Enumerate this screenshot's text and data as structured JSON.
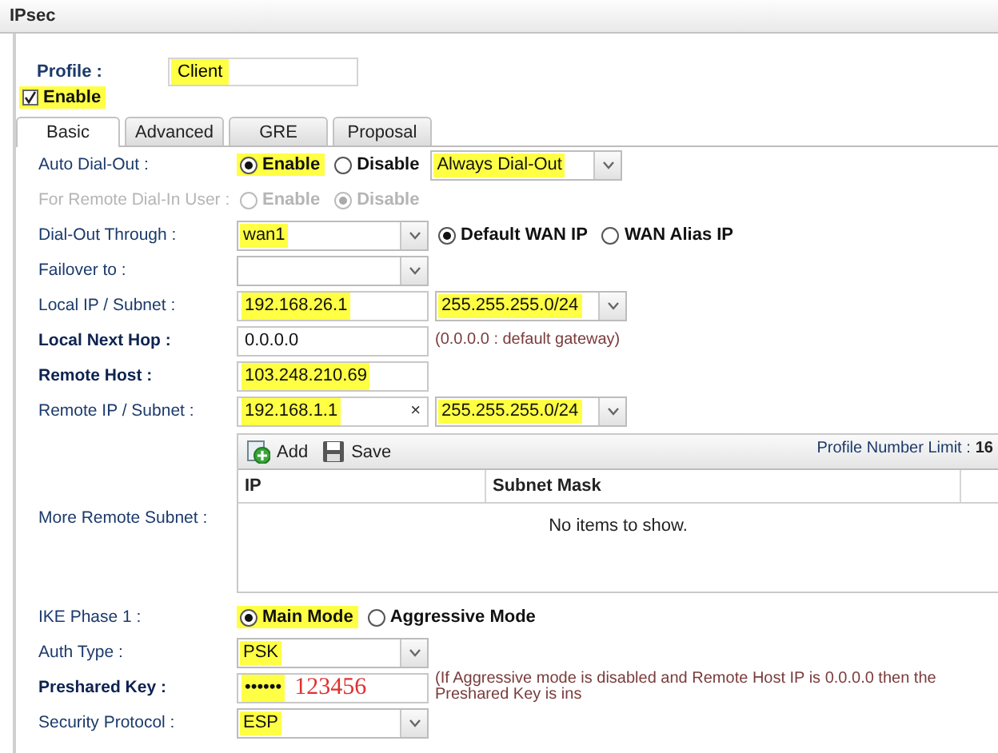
{
  "window": {
    "title": "IPsec"
  },
  "profile": {
    "label": "Profile :",
    "value": "Client",
    "highlighted": true
  },
  "enable": {
    "label": "Enable",
    "checked": true,
    "highlighted": true
  },
  "tabs": [
    {
      "label": "Basic",
      "selected": true
    },
    {
      "label": "Advanced",
      "selected": false
    },
    {
      "label": "GRE",
      "selected": false
    },
    {
      "label": "Proposal",
      "selected": false
    }
  ],
  "rows": [
    {
      "kind": "fields",
      "label": "Auto Dial-Out :",
      "bold": false,
      "disabled": false,
      "controls": [
        {
          "kind": "radio",
          "label": "Enable",
          "selected": true,
          "highlighted": true
        },
        {
          "kind": "radio",
          "label": "Disable",
          "selected": false,
          "highlighted": false
        },
        {
          "kind": "select",
          "value": "Always Dial-Out",
          "highlighted": true
        }
      ]
    },
    {
      "kind": "fields",
      "label": "For Remote Dial-In User :",
      "bold": false,
      "disabled": true,
      "controls": [
        {
          "kind": "radio",
          "label": "Enable",
          "selected": false,
          "highlighted": false
        },
        {
          "kind": "radio",
          "label": "Disable",
          "selected": true,
          "highlighted": false
        }
      ]
    },
    {
      "kind": "fields",
      "label": "Dial-Out Through :",
      "bold": false,
      "disabled": false,
      "controls": [
        {
          "kind": "select",
          "value": "wan1",
          "highlighted": true
        },
        {
          "kind": "radio",
          "label": "Default WAN IP",
          "selected": true,
          "highlighted": false
        },
        {
          "kind": "radio",
          "label": "WAN Alias IP",
          "selected": false,
          "highlighted": false
        }
      ]
    },
    {
      "kind": "fields",
      "label": "Failover to :",
      "bold": false,
      "disabled": false,
      "controls": [
        {
          "kind": "select"
        }
      ]
    },
    {
      "kind": "fields",
      "label": "Local IP / Subnet :",
      "bold": false,
      "disabled": false,
      "controls": [
        {
          "kind": "input",
          "value": "192.168.26.1",
          "highlighted": true
        },
        {
          "kind": "select",
          "value": "255.255.255.0/24",
          "highlighted": true
        }
      ]
    },
    {
      "kind": "fields",
      "label": "Local Next Hop :",
      "bold": true,
      "disabled": false,
      "controls": [
        {
          "kind": "input",
          "value": "0.0.0.0",
          "highlighted": false
        },
        {
          "kind": "note",
          "text": "(0.0.0.0 : default gateway)"
        }
      ]
    },
    {
      "kind": "fields",
      "label": "Remote Host :",
      "bold": true,
      "disabled": false,
      "controls": [
        {
          "kind": "input",
          "value": "103.248.210.69",
          "highlighted": true
        }
      ]
    },
    {
      "kind": "fields",
      "label": "Remote IP / Subnet :",
      "bold": false,
      "disabled": false,
      "controls": [
        {
          "kind": "input",
          "value": "192.168.1.1",
          "highlighted": true,
          "clear": "×"
        },
        {
          "kind": "select",
          "value": "255.255.255.0/24",
          "highlighted": true
        }
      ]
    },
    {
      "kind": "table",
      "label": "More Remote Subnet :",
      "toolbar": [
        "Add",
        "Save"
      ],
      "limit_label": "Profile Number Limit :",
      "limit_value": "16",
      "columns": [
        "IP",
        "Subnet Mask"
      ],
      "empty_text": "No items to show."
    },
    {
      "kind": "fields",
      "label": "IKE Phase 1 :",
      "bold": false,
      "disabled": false,
      "controls": [
        {
          "kind": "radio",
          "label": "Main Mode",
          "selected": true,
          "highlighted": true
        },
        {
          "kind": "radio",
          "label": "Aggressive Mode",
          "selected": false,
          "highlighted": false
        }
      ]
    },
    {
      "kind": "fields",
      "label": "Auth Type :",
      "bold": false,
      "disabled": false,
      "controls": [
        {
          "kind": "select",
          "value": "PSK",
          "highlighted": true
        }
      ]
    },
    {
      "kind": "fields",
      "label": "Preshared Key :",
      "bold": true,
      "disabled": false,
      "controls": [
        {
          "kind": "input",
          "value": "••••••",
          "highlighted": true,
          "annotation": "123456"
        },
        {
          "kind": "note",
          "text": "(If Aggressive mode is disabled and Remote Host IP is 0.0.0.0 then the Preshared Key is ins"
        }
      ]
    },
    {
      "kind": "fields",
      "label": "Security Protocol :",
      "bold": false,
      "disabled": false,
      "controls": [
        {
          "kind": "select",
          "value": "ESP",
          "highlighted": true
        }
      ]
    }
  ]
}
